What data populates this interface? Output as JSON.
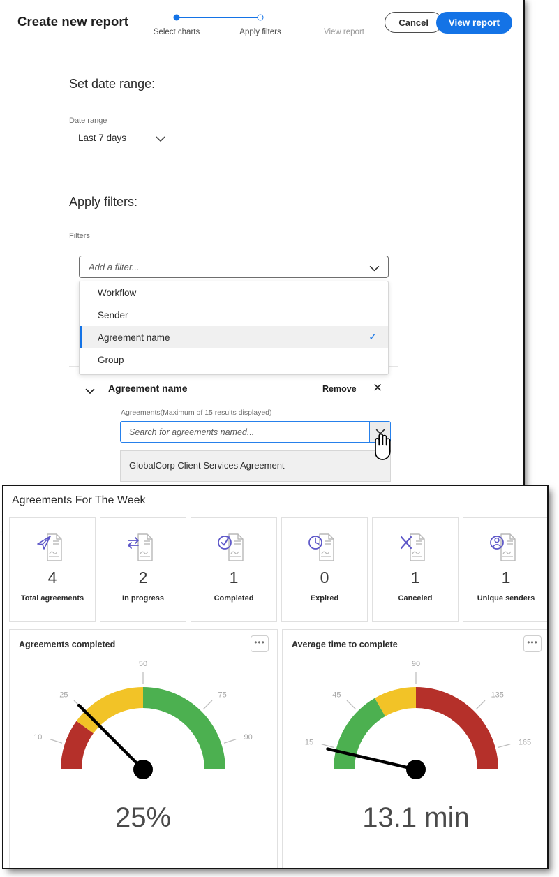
{
  "header": {
    "title": "Create new report",
    "cancel_label": "Cancel",
    "view_report_label": "View report",
    "accent_color": "#1473e6",
    "steps": [
      {
        "label": "Select charts",
        "state": "filled"
      },
      {
        "label": "Apply filters",
        "state": "hollow"
      },
      {
        "label": "View report",
        "state": "inactive"
      }
    ]
  },
  "date_section": {
    "heading": "Set date range:",
    "field_label": "Date range",
    "value": "Last 7 days",
    "caret_icon": "chevron-down-icon"
  },
  "filter_section": {
    "heading": "Apply filters:",
    "field_label": "Filters",
    "combo_placeholder": "Add a filter...",
    "caret_icon": "chevron-down-icon",
    "options": [
      {
        "label": "Workflow",
        "selected": false
      },
      {
        "label": "Sender",
        "selected": false
      },
      {
        "label": "Agreement name",
        "selected": true
      },
      {
        "label": "Group",
        "selected": false
      }
    ],
    "check_glyph": "✓"
  },
  "agreement_filter": {
    "title": "Agreement name",
    "chevron_icon": "chevron-down-icon",
    "remove_label": "Remove",
    "close_glyph": "✕",
    "sub_label": "Agreements(Maximum of 15 results displayed)",
    "search_placeholder": "Search for agreements named...",
    "search_value": "",
    "toggle_icon": "chevron-down-icon",
    "results": [
      "GlobalCorp Client Services Agreement"
    ]
  },
  "report": {
    "title": "Agreements For The Week",
    "kpis": [
      {
        "value": "4",
        "label": "Total agreements",
        "icon": "paper-plane-document-icon"
      },
      {
        "value": "2",
        "label": "In progress",
        "icon": "transfer-document-icon"
      },
      {
        "value": "1",
        "label": "Completed",
        "icon": "check-document-icon"
      },
      {
        "value": "0",
        "label": "Expired",
        "icon": "clock-document-icon"
      },
      {
        "value": "1",
        "label": "Canceled",
        "icon": "x-document-icon"
      },
      {
        "value": "1",
        "label": "Unique senders",
        "icon": "person-document-icon"
      }
    ],
    "menu_glyph": "•••",
    "icon_color": "#5c56c8",
    "icon_outline_color": "#b8b8b8"
  },
  "chart_data": [
    {
      "type": "gauge",
      "title": "Agreements completed",
      "value": 25,
      "display_value": "25%",
      "units": "%",
      "range": [
        0,
        100
      ],
      "tick_labels": [
        "10",
        "25",
        "50",
        "75",
        "90"
      ],
      "tick_values": [
        10,
        25,
        50,
        75,
        90
      ],
      "bands": [
        {
          "from": 0,
          "to": 20,
          "color": "#b5302a"
        },
        {
          "from": 20,
          "to": 50,
          "color": "#f2c327"
        },
        {
          "from": 50,
          "to": 100,
          "color": "#4cb050"
        }
      ],
      "needle_color": "#000000",
      "legend": "none",
      "grid": false
    },
    {
      "type": "gauge",
      "title": "Average time to complete",
      "value": 13.1,
      "display_value": "13.1 min",
      "units": "min",
      "range": [
        0,
        180
      ],
      "tick_labels": [
        "15",
        "45",
        "90",
        "135",
        "165"
      ],
      "tick_values": [
        15,
        45,
        90,
        135,
        165
      ],
      "bands": [
        {
          "from": 0,
          "to": 60,
          "color": "#4cb050"
        },
        {
          "from": 60,
          "to": 90,
          "color": "#f2c327"
        },
        {
          "from": 90,
          "to": 180,
          "color": "#b5302a"
        }
      ],
      "needle_color": "#000000",
      "legend": "none",
      "grid": false
    }
  ]
}
